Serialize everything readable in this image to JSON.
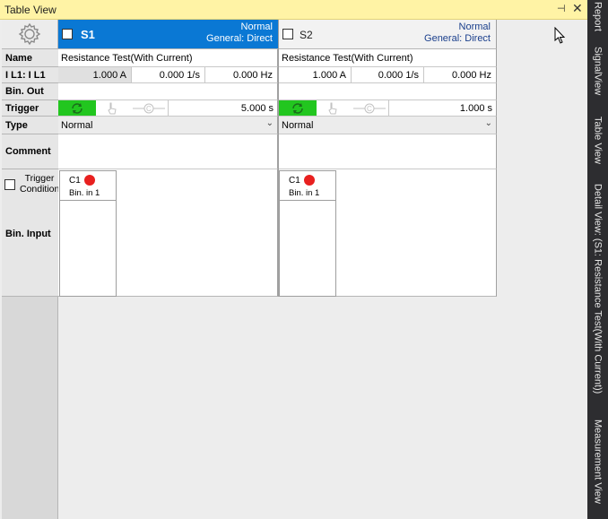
{
  "panel": {
    "title": "Table View",
    "pin_icon": "pin-icon",
    "close_icon": "close-icon"
  },
  "row_labels": {
    "name": "Name",
    "current": "I L1: I L1",
    "bin_out": "Bin. Out",
    "trigger": "Trigger",
    "type": "Type",
    "comment": "Comment",
    "trigger_condition": "Trigger Condition",
    "bin_input": "Bin. Input"
  },
  "states": [
    {
      "id": "S1",
      "selected": true,
      "mode_line1": "Normal",
      "mode_line2": "General: Direct",
      "name": "Resistance Test(With Current)",
      "current": "1.000 A",
      "rate": "0.000 1/s",
      "freq": "0.000 Hz",
      "trigger_time": "5.000 s",
      "type": "Normal",
      "comment": "",
      "bin_card": {
        "channel": "C1",
        "input": "Bin. in 1",
        "status_color": "#e8201f"
      }
    },
    {
      "id": "S2",
      "selected": false,
      "mode_line1": "Normal",
      "mode_line2": "General: Direct",
      "name": "Resistance Test(With Current)",
      "current": "1.000 A",
      "rate": "0.000 1/s",
      "freq": "0.000 Hz",
      "trigger_time": "1.000 s",
      "type": "Normal",
      "comment": "",
      "bin_card": {
        "channel": "C1",
        "input": "Bin. in 1",
        "status_color": "#e8201f"
      }
    }
  ],
  "right_tabs": [
    "Report",
    "SignalView",
    "Table View",
    "Detail View: (S1: Resistance Test(With Current))",
    "Measurement View"
  ],
  "colors": {
    "selected_header": "#0a78d4",
    "trigger_active": "#22c61f",
    "panel_title_bg": "#fff3a5",
    "sidebar_bg": "#2d2d30"
  }
}
